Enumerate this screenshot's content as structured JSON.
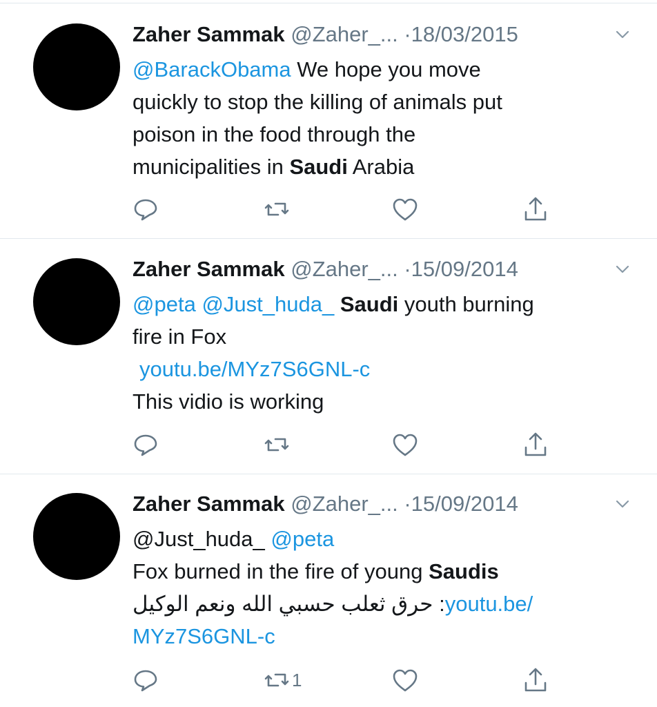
{
  "tweets": [
    {
      "name": "Zaher Sammak",
      "handle": "@Zaher_...",
      "sep": "·",
      "date": "18/03/2015",
      "lines": [
        {
          "m1": "@BarackObama",
          "t1": " We hope you move"
        },
        {
          "t1": "quickly to stop the killing of animals put"
        },
        {
          "t1": "poison in the food through the"
        },
        {
          "t1": "municipalities in ",
          "b1": "Saudi",
          "t2": " Arabia"
        }
      ],
      "retweet_count": ""
    },
    {
      "name": "Zaher Sammak",
      "handle": "@Zaher_...",
      "sep": "·",
      "date": "15/09/2014",
      "lines": [
        {
          "m1": "@peta",
          "t1": " ",
          "m2": "@Just_huda_",
          "t2": " ",
          "b1": "Saudi",
          "t3": " youth burning"
        },
        {
          "t1": "fire in Fox"
        },
        {
          "l1": "youtu.be/MYz7S6GNL-c"
        },
        {
          "t1": "This vidio is working"
        }
      ],
      "retweet_count": ""
    },
    {
      "name": "Zaher Sammak",
      "handle": "@Zaher_...",
      "sep": "·",
      "date": "15/09/2014",
      "lines": [
        {
          "t1": "@Just_huda_ ",
          "m1": "@peta"
        },
        {
          "t1": "Fox burned in the fire of young ",
          "b1": "Saudis"
        },
        {
          "ar": "حرق ثعلب حسبي الله ونعم الوكيل",
          "t1": ":",
          "l1": "youtu.be/"
        },
        {
          "l1": "MYz7S6GNL-c"
        }
      ],
      "retweet_count": "1"
    }
  ],
  "icons": {
    "reply": "reply-icon",
    "retweet": "retweet-icon",
    "like": "heart-icon",
    "share": "share-icon",
    "caret": "chevron-down-icon"
  },
  "colors": {
    "link": "#1b95e0",
    "secondary": "#657786",
    "text": "#14171a",
    "divider": "#e1e8ed"
  }
}
